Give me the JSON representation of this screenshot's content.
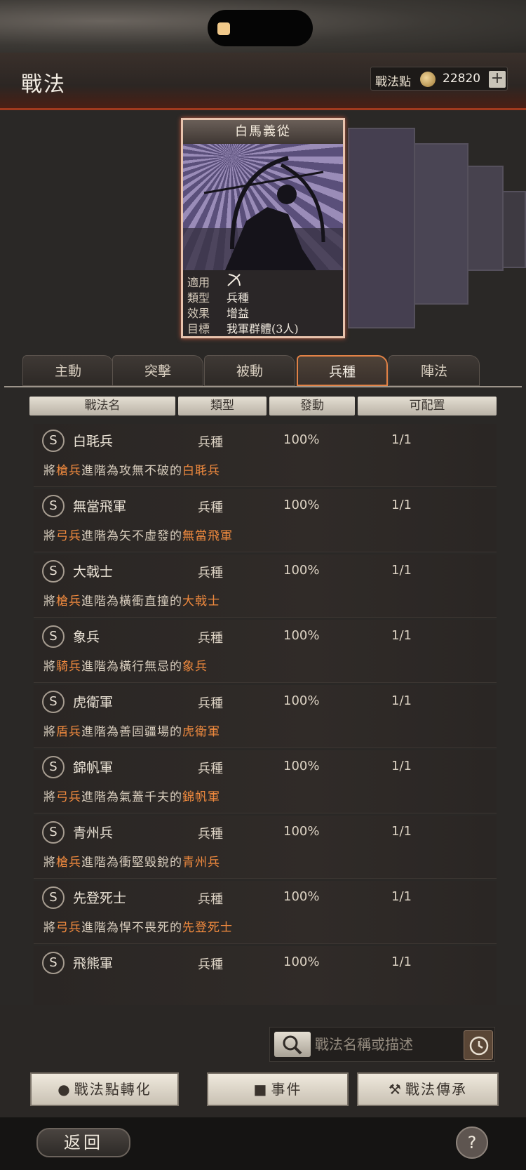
{
  "header": {
    "title": "戰法",
    "points_label": "戰法點",
    "points_value": "22820",
    "plus_label": "+"
  },
  "card": {
    "title": "白馬義從",
    "info": [
      {
        "key": "適用",
        "value": ""
      },
      {
        "key": "類型",
        "value": "兵種"
      },
      {
        "key": "效果",
        "value": "增益"
      },
      {
        "key": "目標",
        "value": "我軍群體(3人)"
      }
    ],
    "applies_icon": "bow-icon"
  },
  "tabs": [
    {
      "label": "主動",
      "active": false
    },
    {
      "label": "突擊",
      "active": false
    },
    {
      "label": "被動",
      "active": false
    },
    {
      "label": "兵種",
      "active": true
    },
    {
      "label": "陣法",
      "active": false
    }
  ],
  "columns": [
    "戰法名",
    "類型",
    "發動",
    "可配置"
  ],
  "rows": [
    {
      "grade": "S",
      "name": "白毦兵",
      "type": "兵種",
      "rate": "100%",
      "slots": "1/1",
      "desc": [
        {
          "t": "將",
          "h": false
        },
        {
          "t": "槍兵",
          "h": true
        },
        {
          "t": "進階為攻無不破的",
          "h": false
        },
        {
          "t": "白毦兵",
          "h": true
        }
      ]
    },
    {
      "grade": "S",
      "name": "無當飛軍",
      "type": "兵種",
      "rate": "100%",
      "slots": "1/1",
      "desc": [
        {
          "t": "將",
          "h": false
        },
        {
          "t": "弓兵",
          "h": true
        },
        {
          "t": "進階為矢不虛發的",
          "h": false
        },
        {
          "t": "無當飛軍",
          "h": true
        }
      ]
    },
    {
      "grade": "S",
      "name": "大戟士",
      "type": "兵種",
      "rate": "100%",
      "slots": "1/1",
      "desc": [
        {
          "t": "將",
          "h": false
        },
        {
          "t": "槍兵",
          "h": true
        },
        {
          "t": "進階為橫衝直撞的",
          "h": false
        },
        {
          "t": "大戟士",
          "h": true
        }
      ]
    },
    {
      "grade": "S",
      "name": "象兵",
      "type": "兵種",
      "rate": "100%",
      "slots": "1/1",
      "desc": [
        {
          "t": "將",
          "h": false
        },
        {
          "t": "騎兵",
          "h": true
        },
        {
          "t": "進階為橫行無忌的",
          "h": false
        },
        {
          "t": "象兵",
          "h": true
        }
      ]
    },
    {
      "grade": "S",
      "name": "虎衛軍",
      "type": "兵種",
      "rate": "100%",
      "slots": "1/1",
      "desc": [
        {
          "t": "將",
          "h": false
        },
        {
          "t": "盾兵",
          "h": true
        },
        {
          "t": "進階為善固疆場的",
          "h": false
        },
        {
          "t": "虎衛軍",
          "h": true
        }
      ]
    },
    {
      "grade": "S",
      "name": "錦帆軍",
      "type": "兵種",
      "rate": "100%",
      "slots": "1/1",
      "desc": [
        {
          "t": "將",
          "h": false
        },
        {
          "t": "弓兵",
          "h": true
        },
        {
          "t": "進階為氣蓋千夫的",
          "h": false
        },
        {
          "t": "錦帆軍",
          "h": true
        }
      ]
    },
    {
      "grade": "S",
      "name": "青州兵",
      "type": "兵種",
      "rate": "100%",
      "slots": "1/1",
      "desc": [
        {
          "t": "將",
          "h": false
        },
        {
          "t": "槍兵",
          "h": true
        },
        {
          "t": "進階為衝堅毀銳的",
          "h": false
        },
        {
          "t": "青州兵",
          "h": true
        }
      ]
    },
    {
      "grade": "S",
      "name": "先登死士",
      "type": "兵種",
      "rate": "100%",
      "slots": "1/1",
      "desc": [
        {
          "t": "將",
          "h": false
        },
        {
          "t": "弓兵",
          "h": true
        },
        {
          "t": "進階為悍不畏死的",
          "h": false
        },
        {
          "t": "先登死士",
          "h": true
        }
      ]
    },
    {
      "grade": "S",
      "name": "飛熊軍",
      "type": "兵種",
      "rate": "100%",
      "slots": "1/1",
      "desc": []
    }
  ],
  "search": {
    "placeholder": "戰法名稱或描述",
    "search_icon": "search-icon",
    "history_icon": "clock-icon"
  },
  "actions": [
    {
      "label": "戰法點轉化",
      "icon": "flame-icon"
    },
    {
      "label": "事件",
      "icon": "event-icon"
    },
    {
      "label": "戰法傳承",
      "icon": "hammer-icon"
    }
  ],
  "footer": {
    "back_label": "返回",
    "help_label": "?"
  },
  "colors": {
    "accent_orange": "#f08a3e",
    "tab_active_border": "#e28246",
    "header_red": "#a03a1e"
  }
}
